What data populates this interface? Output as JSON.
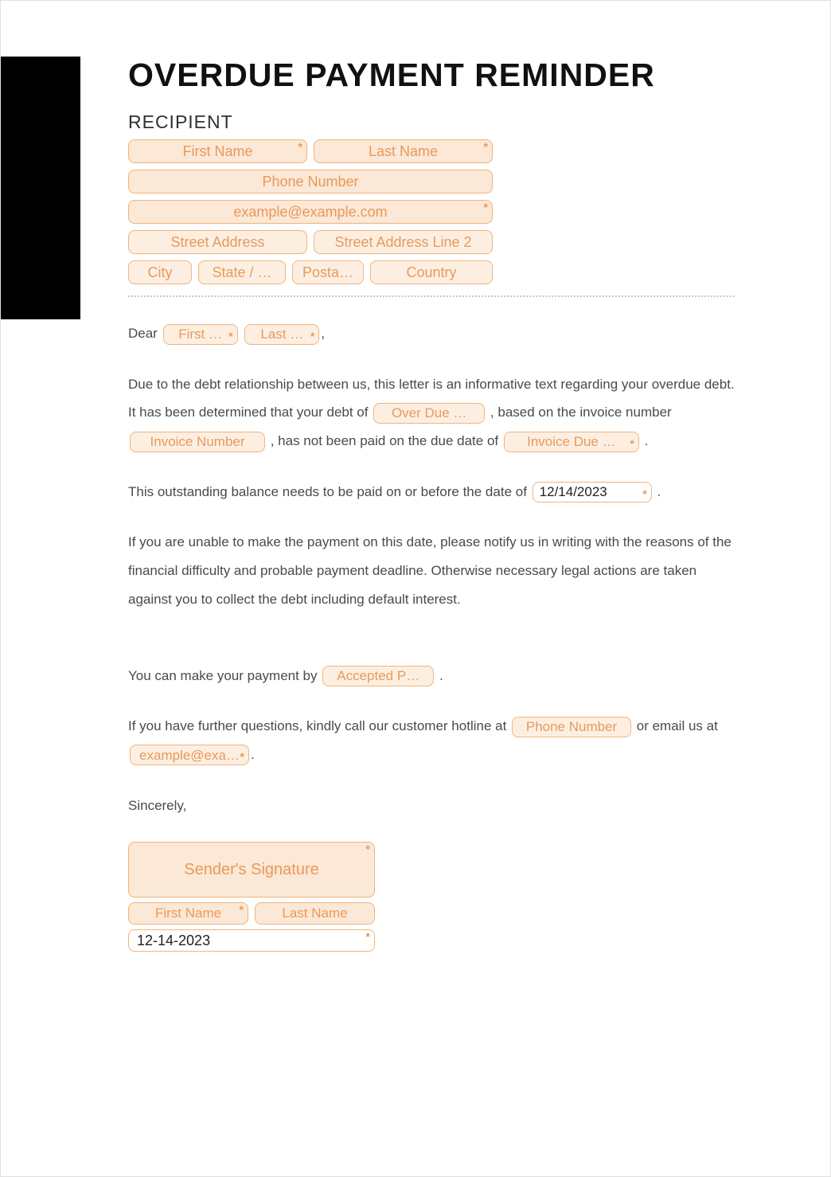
{
  "title": "OVERDUE PAYMENT REMINDER",
  "recipient": {
    "heading": "RECIPIENT",
    "first_name": "First Name",
    "last_name": "Last Name",
    "phone": "Phone Number",
    "email": "example@example.com",
    "street1": "Street Address",
    "street2": "Street Address Line 2",
    "city": "City",
    "state": "State / …",
    "postal": "Posta…",
    "country": "Country"
  },
  "salutation": {
    "dear": "Dear",
    "first": "First …",
    "last": "Last …",
    "comma": ","
  },
  "para1": {
    "t1": "Due to the debt relationship between us, this letter is an informative text regarding your overdue debt. It has been determined that your debt of ",
    "overdue": "Over Due …",
    "t2": " , based on the invoice number ",
    "invoice_no": "Invoice Number",
    "t3": " , has not been paid on the due date of ",
    "invoice_due": "Invoice Due …",
    "t4": " ."
  },
  "para2": {
    "t1": "This outstanding balance needs to be paid on or before the date of ",
    "date": "12/14/2023",
    "t2": " ."
  },
  "para3": "If you are unable to make the payment on this date, please notify us in writing with the reasons of the financial difficulty and probable payment deadline. Otherwise necessary legal actions are taken against you to collect the debt including default interest.",
  "para4": {
    "t1": "You can make your payment by ",
    "method": "Accepted P…",
    "t2": " ."
  },
  "para5": {
    "t1": "If you have further questions, kindly call our customer hotline at ",
    "phone": "Phone Number",
    "t2": " or email us at ",
    "email": "example@exa…",
    "t3": "."
  },
  "closing": "Sincerely,",
  "signature": {
    "label": "Sender's Signature",
    "first": "First Name",
    "last": "Last Name",
    "date": "12-14-2023"
  }
}
